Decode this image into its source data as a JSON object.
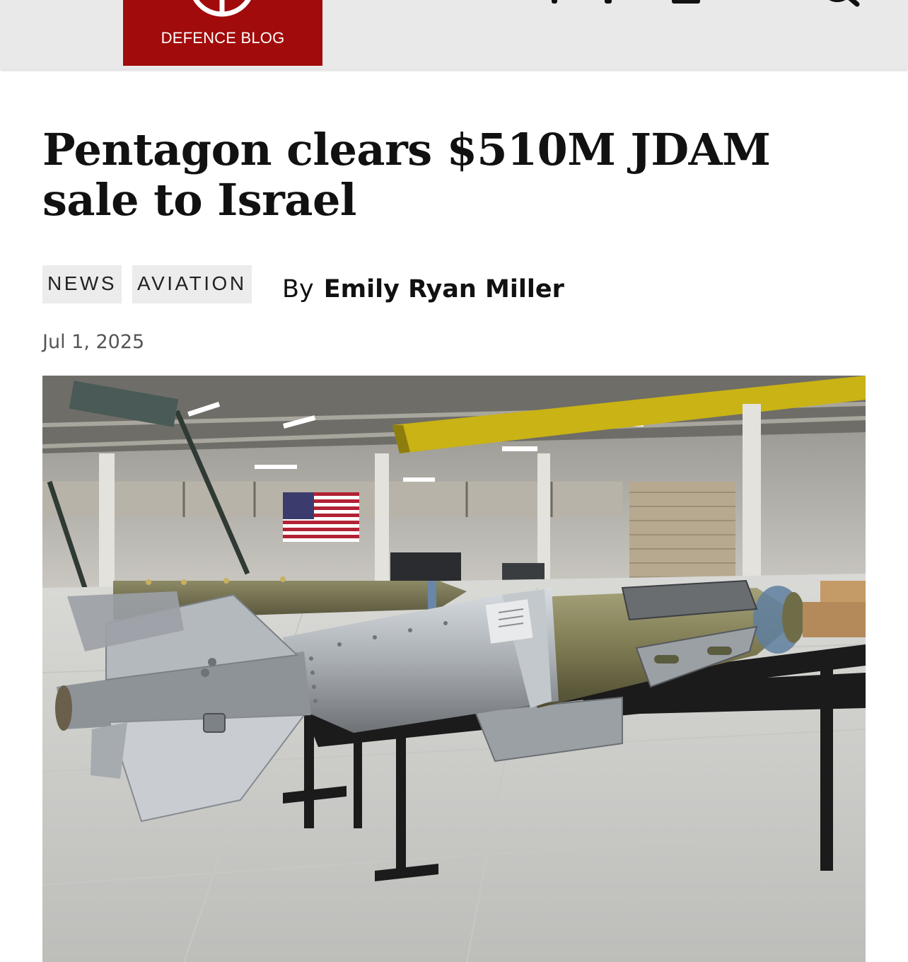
{
  "header": {
    "logo_text": "DEFENCE BLOG"
  },
  "article": {
    "title": "Pentagon clears $510M JDAM sale to Israel",
    "tags": [
      "NEWS",
      "AVIATION"
    ],
    "byline_prefix": "By",
    "author": "Emily Ryan Miller",
    "date": "Jul 1, 2025"
  },
  "icons": {
    "menu": "hamburger-menu-icon",
    "search": "search-icon",
    "logo": "defence-blog-emblem"
  },
  "colors": {
    "brand_red": "#a10b0b",
    "header_bg": "#e9e9e9",
    "tag_bg": "#ececec",
    "text": "#111111",
    "date": "#555555"
  }
}
